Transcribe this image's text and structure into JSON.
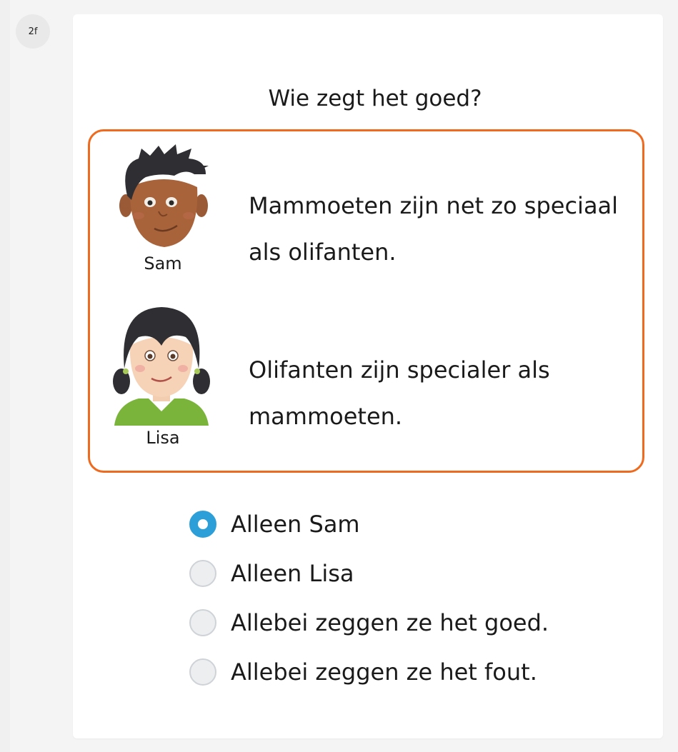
{
  "badge": "2f",
  "question": "Wie zegt het goed?",
  "characters": [
    {
      "name": "Sam",
      "statement": "Mammoeten zijn net zo speciaal als olifanten."
    },
    {
      "name": "Lisa",
      "statement": "Olifanten zijn specialer als mammoeten."
    }
  ],
  "options": [
    {
      "label": "Alleen Sam",
      "selected": true
    },
    {
      "label": "Alleen Lisa",
      "selected": false
    },
    {
      "label": "Allebei zeggen ze het goed.",
      "selected": false
    },
    {
      "label": "Allebei zeggen ze het fout.",
      "selected": false
    }
  ],
  "colors": {
    "accent_border": "#ee6a1f",
    "radio_selected": "#2d9fd8"
  }
}
